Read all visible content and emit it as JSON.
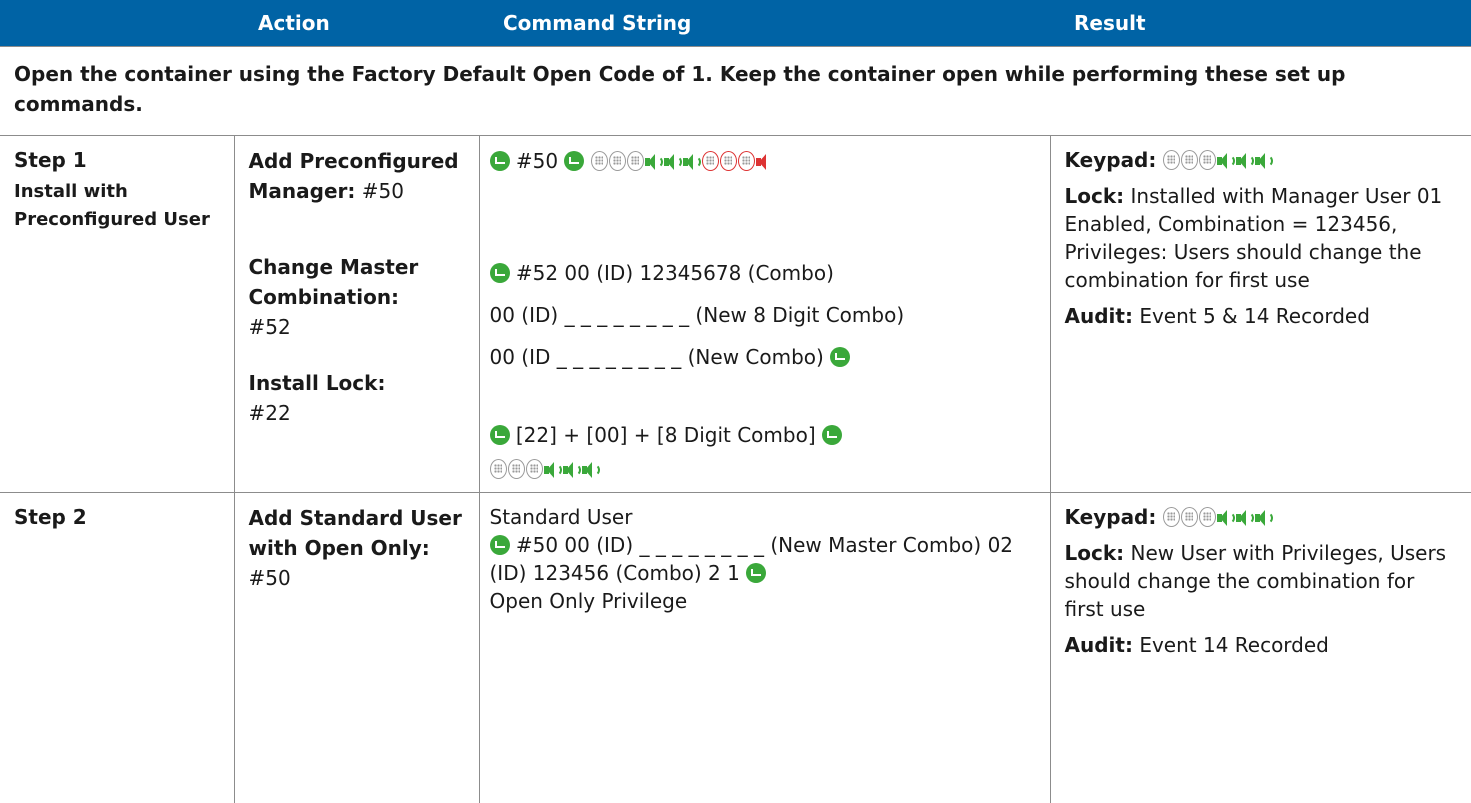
{
  "header": {
    "col1": "",
    "col2": "Action",
    "col3": "Command String",
    "col4": "Result"
  },
  "note": "Open the container using the Factory Default Open Code of 1.  Keep the container open while performing these set up commands.",
  "rows": [
    {
      "step": "Step 1",
      "step_sub": "Install with Preconfigured User",
      "actions": [
        {
          "label": "Add Preconfigured Manager:",
          "code": "#50"
        },
        {
          "label": "Change Master Combination:",
          "code": "#52"
        },
        {
          "label": "Install Lock:",
          "code": "#22"
        }
      ],
      "commands": {
        "line1_code": "#50",
        "line2": "#52 00 (ID) 12345678 (Combo)",
        "line3": "00 (ID) _ _ _ _ _ _ _ _ (New 8 Digit Combo)",
        "line4": "00 (ID _ _ _ _ _ _ _ _ (New Combo)",
        "line5": "[22] + [00] + [8 Digit Combo]"
      },
      "result": {
        "keypad_label": "Keypad:",
        "lock_label": "Lock:",
        "lock_text": "Installed with Manager User 01 Enabled, Combination = 123456, Privileges: Users should change the combination for first use",
        "audit_label": "Audit:",
        "audit_text": "Event 5 & 14 Recorded"
      }
    },
    {
      "step": "Step 2",
      "actions": [
        {
          "label": "Add Standard User with Open Only:",
          "code": "#50"
        }
      ],
      "commands": {
        "line1": "Standard User",
        "line2a": "#50  00 (ID) _ _ _ _ _ _ _ _ (New Master Combo) 02 (ID)  123456 (Combo)  2 1",
        "line3": "Open Only Privilege"
      },
      "result": {
        "keypad_label": "Keypad:",
        "lock_label": "Lock:",
        "lock_text": "New User with Privileges, Users should change the combination for first use",
        "audit_label": "Audit:",
        "audit_text": "Event 14 Recorded"
      }
    }
  ],
  "colors": {
    "header_bg": "#0063a5",
    "enter_green": "#3aa83a",
    "error_red": "#dd3333"
  }
}
